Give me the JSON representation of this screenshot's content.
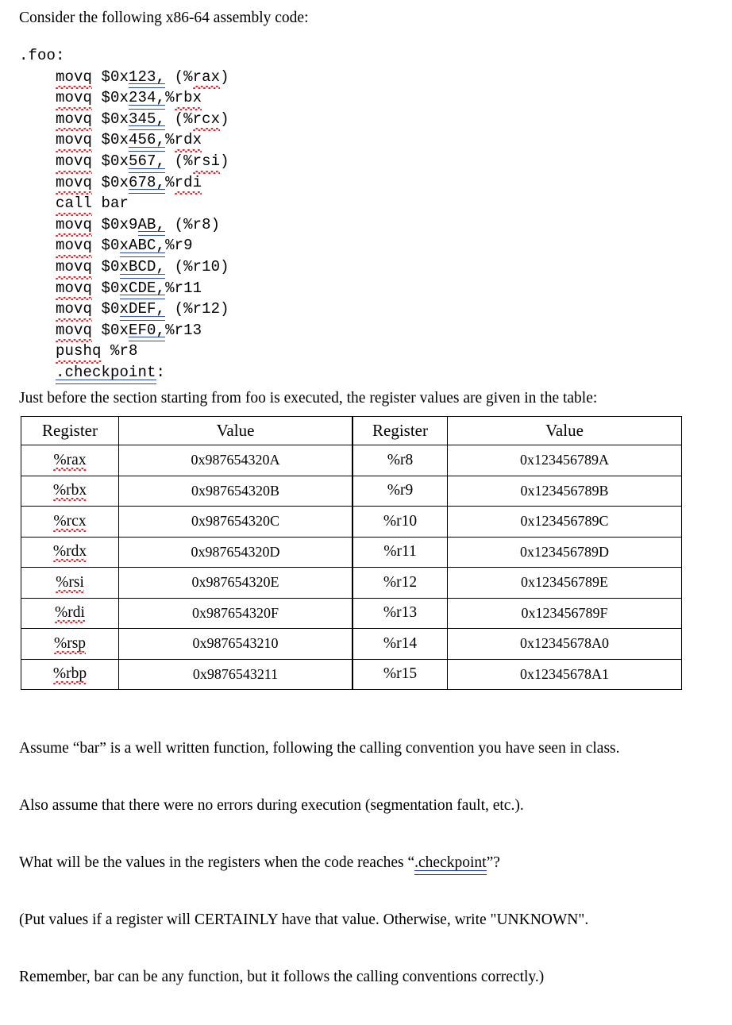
{
  "document": {
    "intro_line": "Consider the following x86-64 assembly code:",
    "table_intro": "Just before the section starting from foo is executed, the register values are given in the table:"
  },
  "code": {
    "label_start": ".foo",
    "label_start_colon": ":",
    "label_end": ".checkpoint",
    "label_end_colon": ":",
    "lines": [
      {
        "mnemonic": "movq",
        "operands_pre": " $0x",
        "grammar": "123,",
        "operands_post": " (%",
        "reg": "rax",
        "operands_tail": ")"
      },
      {
        "mnemonic": "movq",
        "operands_pre": " $0x",
        "grammar": "234,",
        "operands_post": "%",
        "reg": "rbx",
        "operands_tail": ""
      },
      {
        "mnemonic": "movq",
        "operands_pre": " $0x",
        "grammar": "345,",
        "operands_post": " (%",
        "reg": "rcx",
        "operands_tail": ")"
      },
      {
        "mnemonic": "movq",
        "operands_pre": " $0x",
        "grammar": "456,",
        "operands_post": "%",
        "reg": "rdx",
        "operands_tail": ""
      },
      {
        "mnemonic": "movq",
        "operands_pre": " $0x",
        "grammar": "567,",
        "operands_post": " (%",
        "reg": "rsi",
        "operands_tail": ")"
      },
      {
        "mnemonic": "movq",
        "operands_pre": " $0x",
        "grammar": "678,",
        "operands_post": "%",
        "reg": "rdi",
        "operands_tail": ""
      },
      {
        "mnemonic": "call",
        "operands_pre": " bar",
        "grammar": "",
        "operands_post": "",
        "reg": "",
        "operands_tail": ""
      },
      {
        "mnemonic": "movq",
        "operands_pre": " $0x9",
        "grammar": "AB,",
        "operands_post": " (%r8",
        "reg": "",
        "operands_tail": ")"
      },
      {
        "mnemonic": "movq",
        "operands_pre": " $0",
        "grammar": "xABC,",
        "operands_post": "%r9",
        "reg": "",
        "operands_tail": ""
      },
      {
        "mnemonic": "movq",
        "operands_pre": " $0",
        "grammar": "xBCD,",
        "operands_post": " (%r10",
        "reg": "",
        "operands_tail": ")"
      },
      {
        "mnemonic": "movq",
        "operands_pre": " $0",
        "grammar": "xCDE,",
        "operands_post": "%r11",
        "reg": "",
        "operands_tail": ""
      },
      {
        "mnemonic": "movq",
        "operands_pre": " $0",
        "grammar": "xDEF,",
        "operands_post": " (%r12",
        "reg": "",
        "operands_tail": ")"
      },
      {
        "mnemonic": "movq",
        "operands_pre": " $0x",
        "grammar": "EF0,",
        "operands_post": "%r13",
        "reg": "",
        "operands_tail": ""
      },
      {
        "mnemonic": "pushq",
        "operands_pre": " %r8",
        "grammar": "",
        "operands_post": "",
        "reg": "",
        "operands_tail": ""
      }
    ]
  },
  "table": {
    "headers": {
      "register": "Register",
      "value": "Value"
    },
    "left_rows": [
      {
        "register": "%rax",
        "value": "0x987654320A"
      },
      {
        "register": "%rbx",
        "value": "0x987654320B"
      },
      {
        "register": "%rcx",
        "value": "0x987654320C"
      },
      {
        "register": "%rdx",
        "value": "0x987654320D"
      },
      {
        "register": "%rsi",
        "value": "0x987654320E"
      },
      {
        "register": "%rdi",
        "value": "0x987654320F"
      },
      {
        "register": "%rsp",
        "value": "0x9876543210"
      },
      {
        "register": "%rbp",
        "value": "0x9876543211"
      }
    ],
    "right_rows": [
      {
        "register": "%r8",
        "value": "0x123456789A"
      },
      {
        "register": "%r9",
        "value": "0x123456789B"
      },
      {
        "register": "%r10",
        "value": "0x123456789C"
      },
      {
        "register": "%r11",
        "value": "0x123456789D"
      },
      {
        "register": "%r12",
        "value": "0x123456789E"
      },
      {
        "register": "%r13",
        "value": "0x123456789F"
      },
      {
        "register": "%r14",
        "value": "0x12345678A0"
      },
      {
        "register": "%r15",
        "value": "0x12345678A1"
      }
    ]
  },
  "closing": {
    "line1": "Assume “bar” is a well written function, following the calling convention you have seen in class.",
    "line2": "Also assume that there were no errors during execution (segmentation fault, etc.).",
    "line3_pre": "What will be the values in the registers when the code reaches “",
    "line3_gram": ".checkpoint",
    "line3_post": "”?",
    "line4": "(Put values if a register will CERTAINLY have that value. Otherwise, write \"UNKNOWN\".",
    "line5": "Remember, bar can be any function, but it follows the calling conventions correctly.)"
  },
  "colors": {
    "text": "#000000",
    "spellcheck_underline": "#e8202a",
    "grammar_underline": "#2346d8",
    "table_border": "#000000",
    "background": "#ffffff"
  }
}
